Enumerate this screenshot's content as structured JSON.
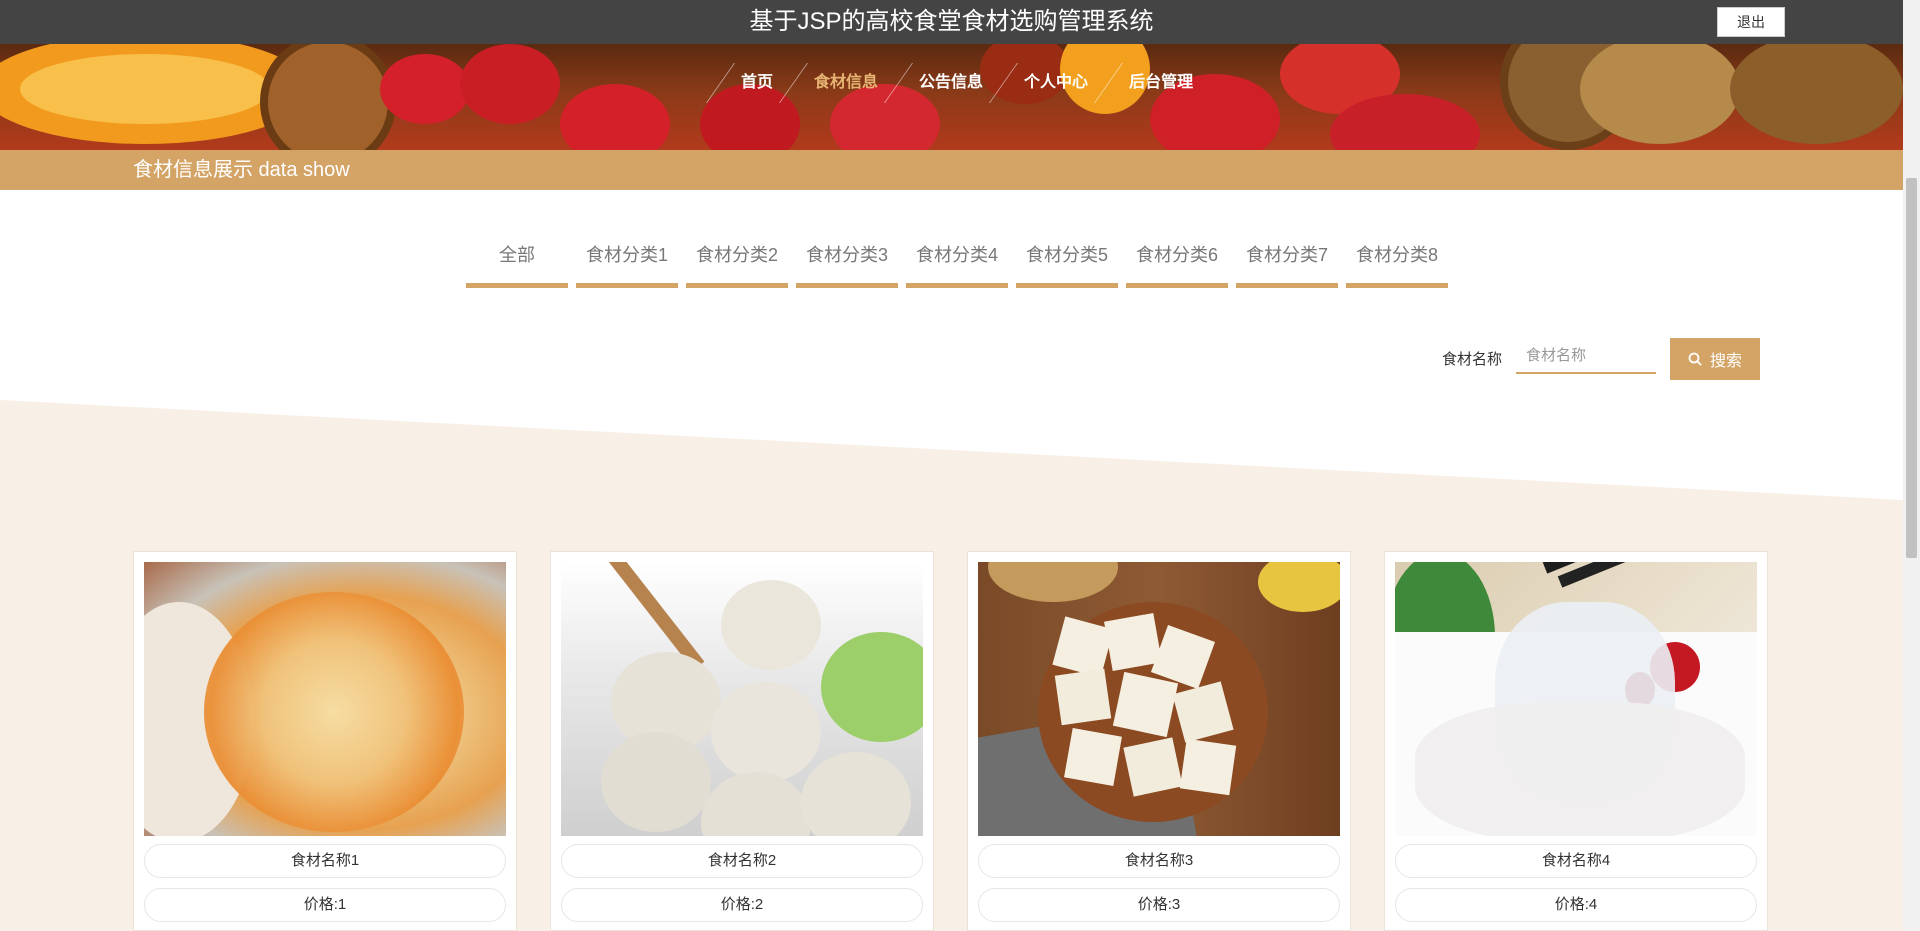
{
  "header": {
    "title": "基于JSP的高校食堂食材选购管理系统",
    "logout_label": "退出"
  },
  "nav": {
    "items": [
      {
        "label": "首页",
        "active": false
      },
      {
        "label": "食材信息",
        "active": true
      },
      {
        "label": "公告信息",
        "active": false
      },
      {
        "label": "个人中心",
        "active": false
      },
      {
        "label": "后台管理",
        "active": false
      }
    ]
  },
  "section": {
    "title": "食材信息展示  data show"
  },
  "categories": [
    "全部",
    "食材分类1",
    "食材分类2",
    "食材分类3",
    "食材分类4",
    "食材分类5",
    "食材分类6",
    "食材分类7",
    "食材分类8"
  ],
  "search": {
    "label": "食材名称",
    "placeholder": "食材名称",
    "value": "",
    "button_label": "搜索"
  },
  "products": [
    {
      "name": "食材名称1",
      "price": "价格:1",
      "image": "shredded-jellyfish-salad"
    },
    {
      "name": "食材名称2",
      "price": "价格:2",
      "image": "fish-balls"
    },
    {
      "name": "食材名称3",
      "price": "价格:3",
      "image": "tofu-on-plate"
    },
    {
      "name": "食材名称4",
      "price": "价格:4",
      "image": "raw-fish-slices"
    }
  ],
  "colors": {
    "topbar": "#444444",
    "accent": "#d4a467",
    "beige": "#f8efe6",
    "active_nav": "#e6b573"
  }
}
